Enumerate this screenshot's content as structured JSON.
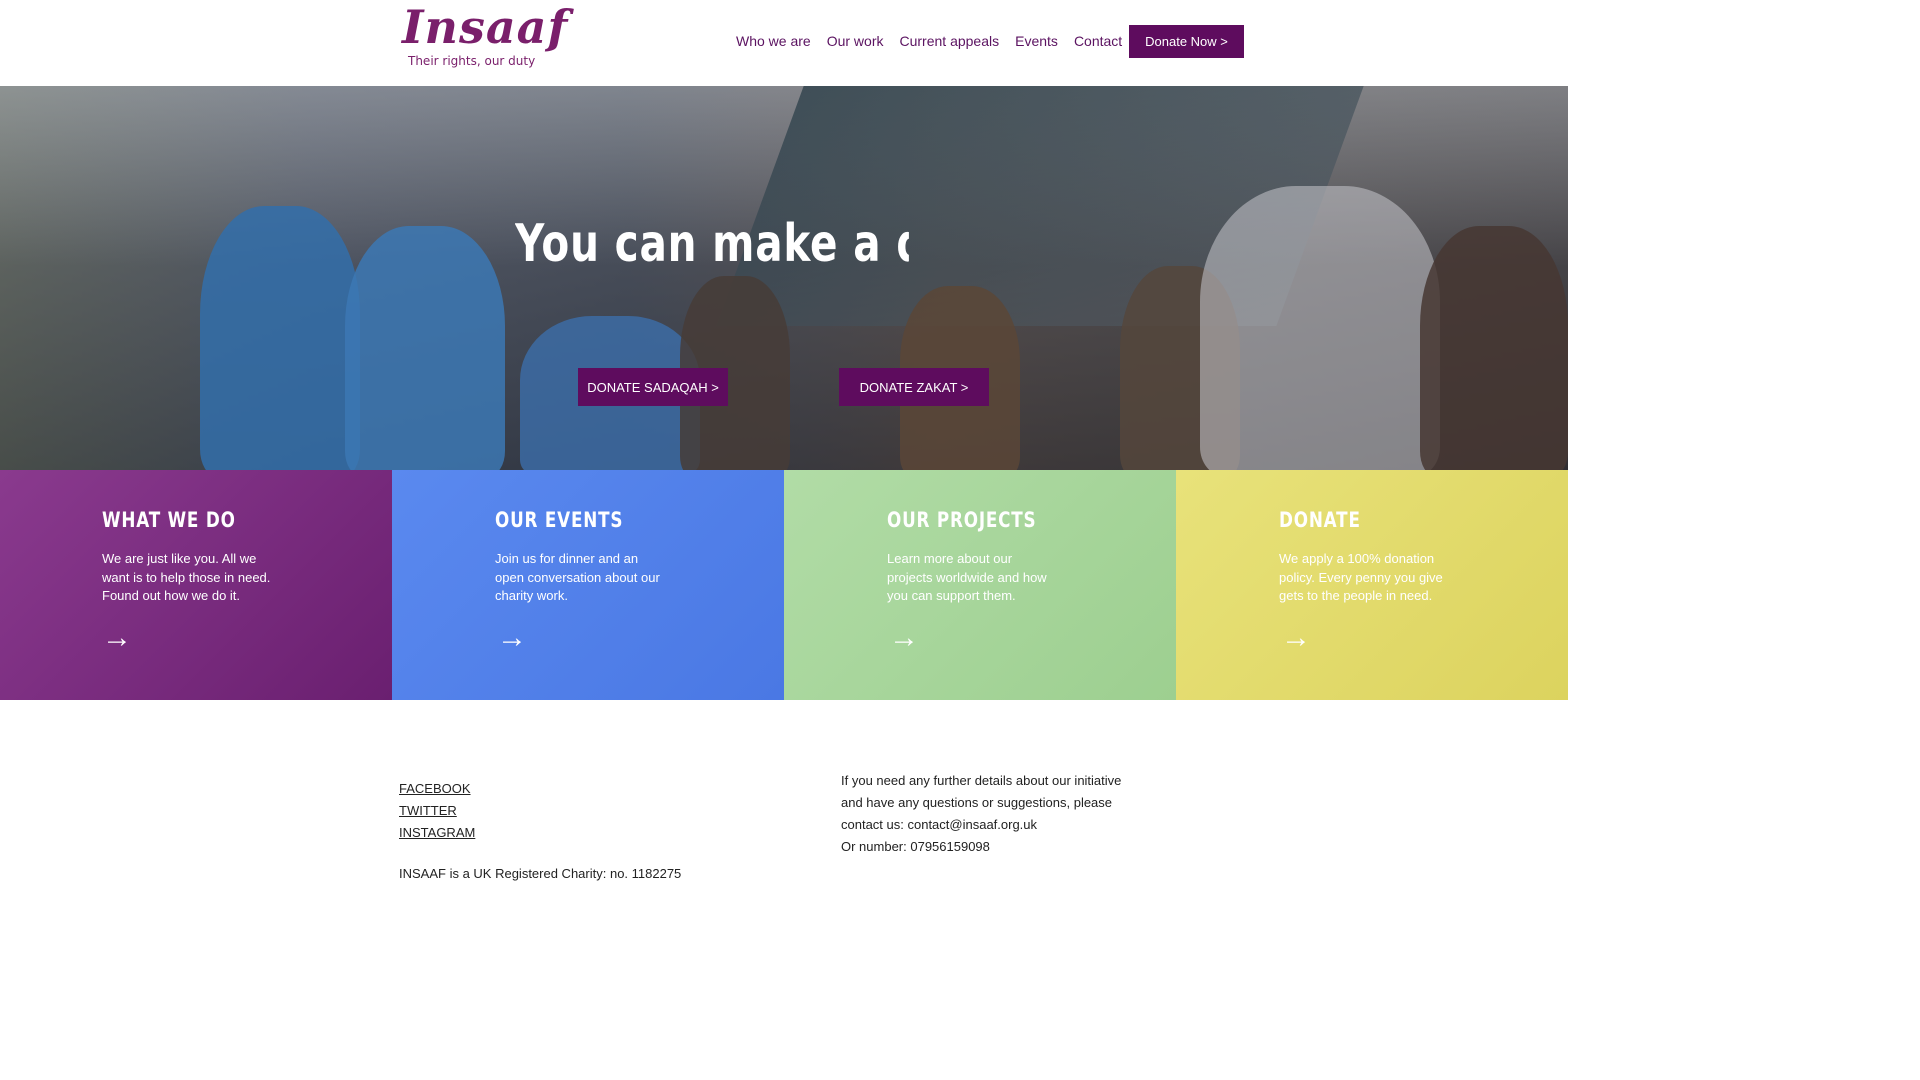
{
  "brand": {
    "logo_word": "Insaaf",
    "tagline": "Their rights, our duty",
    "primary_color": "#5e0c5e"
  },
  "nav": {
    "items": [
      "Who we are",
      "Our work",
      "Current appeals",
      "Events",
      "Contact"
    ],
    "donate_label": "Donate Now >"
  },
  "hero": {
    "title": "You can make a difference",
    "buttons": [
      "DONATE SADAQAH >",
      "DONATE ZAKAT >"
    ]
  },
  "tiles": [
    {
      "title": "WHAT WE DO",
      "text": "We are just like you. All we want is to help those in need. Found out how we do it.",
      "arrow": "→",
      "color": "#7a2a80"
    },
    {
      "title": "OUR EVENTS",
      "text": "Join us for dinner and an open conversation about our charity work.",
      "arrow": "→",
      "color": "#4f7fe8"
    },
    {
      "title": "OUR PROJECTS",
      "text": "Learn more about our projects worldwide and how you can support them.",
      "arrow": "→",
      "color": "#a6d49a"
    },
    {
      "title": "DONATE",
      "text": "We apply a 100% donation policy. Every penny you give gets to the people in need.",
      "arrow": "→",
      "color": "#e3dc6e"
    }
  ],
  "footer": {
    "social": [
      "FACEBOOK",
      "TWITTER",
      "INSTAGRAM"
    ],
    "charity": "INSAAF is a UK Registered Charity: no. 1182275",
    "contact_lines": [
      "If you need any further details about our initiative",
      "and have any questions or suggestions, please",
      "contact us:  contact@insaaf.org.uk",
      "Or number: 07956159098"
    ]
  }
}
